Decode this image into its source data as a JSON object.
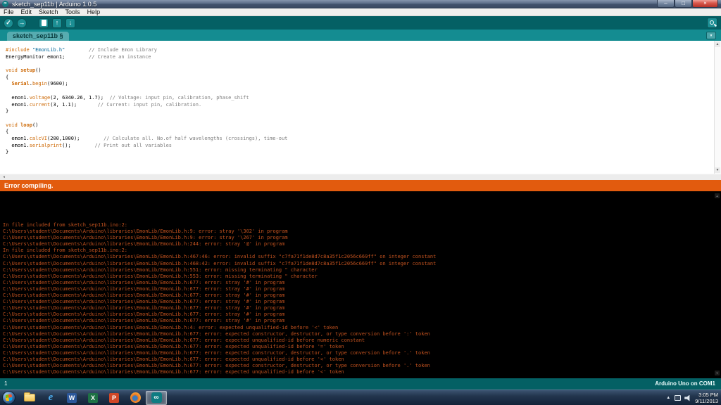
{
  "window": {
    "title": "sketch_sep11b | Arduino 1.0.5",
    "icon_glyph": "∞",
    "controls": {
      "minimize": "–",
      "maximize": "□",
      "close": "×"
    }
  },
  "menu": {
    "items": [
      "File",
      "Edit",
      "Sketch",
      "Tools",
      "Help"
    ]
  },
  "toolbar": {
    "verify_glyph": "✓",
    "upload_glyph": "→",
    "open_glyph": "↑",
    "save_glyph": "↓"
  },
  "tab": {
    "label": "sketch_sep11b §"
  },
  "icons": {
    "chevron_down": "▼",
    "scroll_up": "▲",
    "scroll_down": "▼",
    "hscroll_left": "◄",
    "tray_expand": "▲"
  },
  "editor": {
    "code_lines": [
      {
        "segs": [
          [
            "kw",
            "#include "
          ],
          [
            "str",
            "\"EmonLib.h\""
          ],
          [
            "pl",
            "        "
          ],
          [
            "com",
            "// Include Emon Library"
          ]
        ]
      },
      {
        "segs": [
          [
            "pl",
            "EnergyMonitor emon1;"
          ],
          [
            "pl",
            "        "
          ],
          [
            "com",
            "// Create an instance"
          ]
        ]
      },
      {
        "segs": []
      },
      {
        "segs": [
          [
            "kw",
            "void "
          ],
          [
            "fnb",
            "setup"
          ],
          [
            "pl",
            "()"
          ]
        ]
      },
      {
        "segs": [
          [
            "pl",
            "{"
          ]
        ]
      },
      {
        "segs": [
          [
            "pl",
            "  "
          ],
          [
            "fnb",
            "Serial"
          ],
          [
            "pl",
            "."
          ],
          [
            "kw",
            "begin"
          ],
          [
            "pl",
            "(9600);"
          ]
        ]
      },
      {
        "segs": []
      },
      {
        "segs": [
          [
            "pl",
            "  emon1."
          ],
          [
            "kw",
            "voltage"
          ],
          [
            "pl",
            "(2, 6340.26, 1.7);  "
          ],
          [
            "com",
            "// Voltage: input pin, calibration, phase_shift"
          ]
        ]
      },
      {
        "segs": [
          [
            "pl",
            "  emon1."
          ],
          [
            "kw",
            "current"
          ],
          [
            "pl",
            "(3, 1.1);       "
          ],
          [
            "com",
            "// Current: input pin, calibration."
          ]
        ]
      },
      {
        "segs": [
          [
            "pl",
            "}"
          ]
        ]
      },
      {
        "segs": []
      },
      {
        "segs": [
          [
            "kw",
            "void "
          ],
          [
            "fnb",
            "loop"
          ],
          [
            "pl",
            "()"
          ]
        ]
      },
      {
        "segs": [
          [
            "pl",
            "{"
          ]
        ]
      },
      {
        "segs": [
          [
            "pl",
            "  emon1."
          ],
          [
            "kw",
            "calcVI"
          ],
          [
            "pl",
            "(200,1000);        "
          ],
          [
            "com",
            "// Calculate all. No.of half wavelengths (crossings), time-out"
          ]
        ]
      },
      {
        "segs": [
          [
            "pl",
            "  emon1."
          ],
          [
            "kw",
            "serialprint"
          ],
          [
            "pl",
            "();        "
          ],
          [
            "com",
            "// Print out all variables"
          ]
        ]
      },
      {
        "segs": [
          [
            "pl",
            "}"
          ]
        ]
      }
    ]
  },
  "status": {
    "message": "Error compiling."
  },
  "console": {
    "lines": [
      "In file included from sketch_sep11b.ino:2:",
      "C:\\Users\\student\\Documents\\Arduino\\libraries\\EmonLib/EmonLib.h:9: error: stray '\\302' in program",
      "C:\\Users\\student\\Documents\\Arduino\\libraries\\EmonLib/EmonLib.h:9: error: stray '\\267' in program",
      "C:\\Users\\student\\Documents\\Arduino\\libraries\\EmonLib/EmonLib.h:244: error: stray '@' in program",
      "In file included from sketch_sep11b.ino:2:",
      "C:\\Users\\student\\Documents\\Arduino\\libraries\\EmonLib/EmonLib.h:467:46: error: invalid suffix \"c7fa71f1de8d7c8a35f1c2056c669ff\" on integer constant",
      "C:\\Users\\student\\Documents\\Arduino\\libraries\\EmonLib/EmonLib.h:468:42: error: invalid suffix \"c7fa71f1de8d7c8a35f1c2056c669ff\" on integer constant",
      "C:\\Users\\student\\Documents\\Arduino\\libraries\\EmonLib/EmonLib.h:551: error: missing terminating \" character",
      "C:\\Users\\student\\Documents\\Arduino\\libraries\\EmonLib/EmonLib.h:553: error: missing terminating \" character",
      "C:\\Users\\student\\Documents\\Arduino\\libraries\\EmonLib/EmonLib.h:677: error: stray '#' in program",
      "C:\\Users\\student\\Documents\\Arduino\\libraries\\EmonLib/EmonLib.h:677: error: stray '#' in program",
      "C:\\Users\\student\\Documents\\Arduino\\libraries\\EmonLib/EmonLib.h:677: error: stray '#' in program",
      "C:\\Users\\student\\Documents\\Arduino\\libraries\\EmonLib/EmonLib.h:677: error: stray '#' in program",
      "C:\\Users\\student\\Documents\\Arduino\\libraries\\EmonLib/EmonLib.h:677: error: stray '#' in program",
      "C:\\Users\\student\\Documents\\Arduino\\libraries\\EmonLib/EmonLib.h:677: error: stray '#' in program",
      "C:\\Users\\student\\Documents\\Arduino\\libraries\\EmonLib/EmonLib.h:677: error: stray '#' in program",
      "C:\\Users\\student\\Documents\\Arduino\\libraries\\EmonLib/EmonLib.h:4: error: expected unqualified-id before '<' token",
      "C:\\Users\\student\\Documents\\Arduino\\libraries\\EmonLib/EmonLib.h:677: error: expected constructor, destructor, or type conversion before ':' token",
      "C:\\Users\\student\\Documents\\Arduino\\libraries\\EmonLib/EmonLib.h:677: error: expected unqualified-id before numeric constant",
      "C:\\Users\\student\\Documents\\Arduino\\libraries\\EmonLib/EmonLib.h:677: error: expected unqualified-id before '=' token",
      "C:\\Users\\student\\Documents\\Arduino\\libraries\\EmonLib/EmonLib.h:677: error: expected constructor, destructor, or type conversion before '.' token",
      "C:\\Users\\student\\Documents\\Arduino\\libraries\\EmonLib/EmonLib.h:677: error: expected unqualified-id before '<' token",
      "C:\\Users\\student\\Documents\\Arduino\\libraries\\EmonLib/EmonLib.h:677: error: expected constructor, destructor, or type conversion before '.' token",
      "C:\\Users\\student\\Documents\\Arduino\\libraries\\EmonLib/EmonLib.h:677: error: expected unqualified-id before '<' token"
    ]
  },
  "footer": {
    "line_number": "1",
    "board_info": "Arduino Uno on COM1"
  },
  "taskbar": {
    "letters": {
      "ie": "e",
      "word": "W",
      "excel": "X",
      "powerpoint": "P"
    },
    "arduino_glyph": "∞",
    "clock": {
      "time": "3:05 PM",
      "date": "9/11/2013"
    }
  },
  "colors": {
    "toolbar_teal": "#046064",
    "tabstrip_teal": "#148c91",
    "error_bar_orange": "#e25b0e",
    "console_error_text": "#c2521f"
  }
}
